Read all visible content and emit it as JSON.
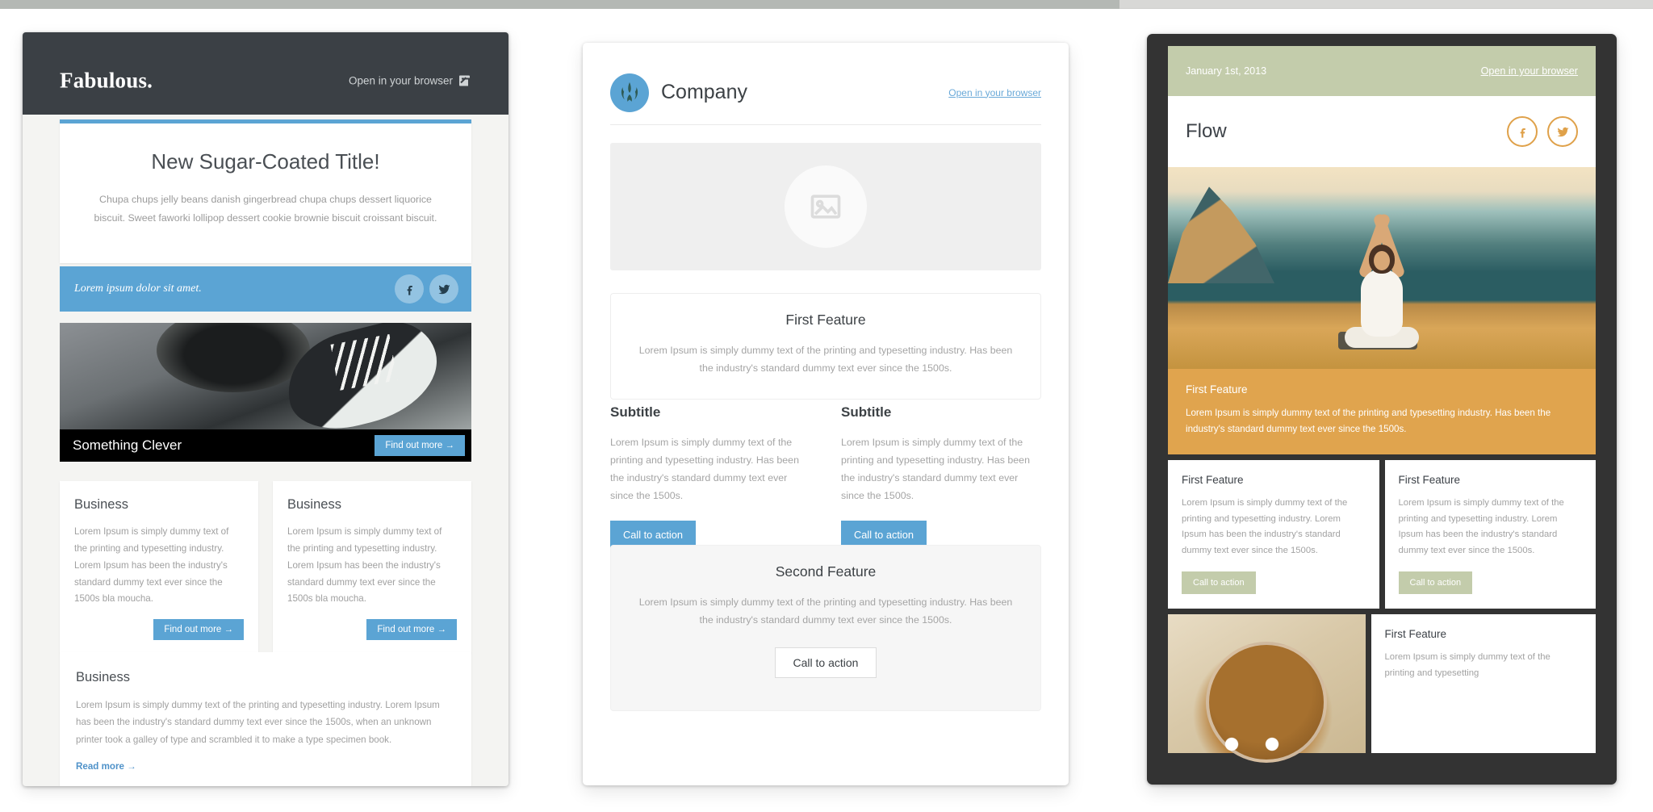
{
  "scrollbar": {
    "thumb_label": "horizontal-scroll-thumb"
  },
  "template1": {
    "brand": "Fabulous.",
    "open_in_browser": "Open in your browser",
    "hero": {
      "title": "New Sugar-Coated Title!",
      "body": "Chupa chups jelly beans danish gingerbread chupa chups dessert liquorice biscuit. Sweet faworki lollipop dessert cookie brownie biscuit croissant biscuit."
    },
    "blue_bar": {
      "text": "Lorem ipsum dolor sit amet.",
      "facebook": "f",
      "twitter": "t"
    },
    "photo_caption": "Something Clever",
    "photo_button": "Find out more →",
    "cards": [
      {
        "title": "Business",
        "body": "Lorem Ipsum is simply dummy text of the printing and typesetting industry. Lorem Ipsum has been the industry's standard dummy text ever since the 1500s bla moucha.",
        "button": "Find out more →"
      },
      {
        "title": "Business",
        "body": "Lorem Ipsum is simply dummy text of the printing and typesetting industry. Lorem Ipsum has been the industry's standard dummy text ever since the 1500s bla moucha.",
        "button": "Find out more →"
      }
    ],
    "wide_card": {
      "title": "Business",
      "body": "Lorem Ipsum is simply dummy text of the printing and typesetting industry. Lorem Ipsum has been the industry's standard dummy text ever since the 1500s, when an unknown printer took a galley of type and scrambled it to make a type specimen book.",
      "link": "Read more →"
    },
    "colors": {
      "header": "#3b4045",
      "accent": "#5ba4d4",
      "caption_bar": "#000000"
    }
  },
  "template2": {
    "company_name": "Company",
    "open_in_browser": "Open in your browser",
    "image_placeholder": "image-placeholder",
    "first_feature": {
      "title": "First Feature",
      "body": "Lorem Ipsum is simply dummy text of the printing and typesetting industry. Has been the industry's standard dummy text ever since the 1500s."
    },
    "columns": [
      {
        "title": "Subtitle",
        "body": "Lorem Ipsum is simply dummy text of the printing and typesetting industry. Has been the industry's standard dummy text ever since the 1500s.",
        "button": "Call to action"
      },
      {
        "title": "Subtitle",
        "body": "Lorem Ipsum is simply dummy text of the printing and typesetting industry. Has been the industry's standard dummy text ever since the 1500s.",
        "button": "Call to action"
      }
    ],
    "second_feature": {
      "title": "Second Feature",
      "body": "Lorem Ipsum is simply dummy text of the printing and typesetting industry. Has been the industry's standard dummy text ever since the 1500s.",
      "button": "Call to action"
    },
    "colors": {
      "accent": "#5ba4d4",
      "panel": "#f6f6f6"
    }
  },
  "template3": {
    "date": "January 1st, 2013",
    "open_in_browser": "Open in your browser",
    "title": "Flow",
    "hero_image": "yoga-sunset-photo",
    "orange_feature": {
      "title": "First Feature",
      "body": "Lorem Ipsum is simply dummy text of the printing and typesetting industry. Has been the industry's standard dummy text ever since the 1500s."
    },
    "cards": [
      {
        "title": "First Feature",
        "body": "Lorem Ipsum is simply dummy text of the printing and typesetting industry. Lorem Ipsum has been the industry's standard dummy text ever since the 1500s.",
        "button": "Call to action"
      },
      {
        "title": "First Feature",
        "body": "Lorem Ipsum is simply dummy text of the printing and typesetting industry. Lorem Ipsum has been the industry's standard dummy text ever since the 1500s.",
        "button": "Call to action"
      }
    ],
    "bottom_row": {
      "image": "coffee-cup-photo",
      "card": {
        "title": "First Feature",
        "body": "Lorem Ipsum is simply dummy text of the printing and typesetting"
      }
    },
    "colors": {
      "frame": "#333333",
      "date_bar": "#c3ccab",
      "orange": "#e0a44e",
      "icon": "#dfa14a"
    }
  }
}
